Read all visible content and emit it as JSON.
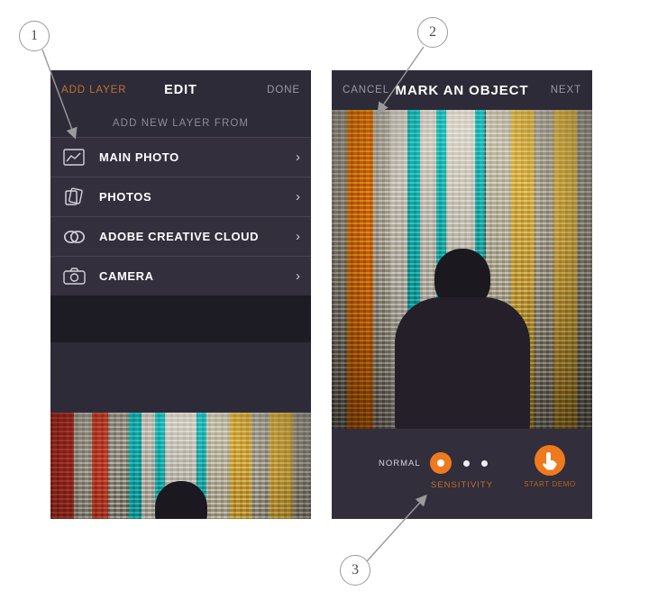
{
  "page": {
    "background": "#ffffff",
    "accent": "#c0702d",
    "accent_bright": "#ef7a1e",
    "panel_bg": "#2e2b39"
  },
  "left_phone": {
    "navbar": {
      "left_label": "ADD LAYER",
      "title": "EDIT",
      "right_label": "DONE"
    },
    "section_header": "ADD NEW LAYER FROM",
    "items": [
      {
        "label": "MAIN PHOTO",
        "icon": "image-icon",
        "chevron": "›"
      },
      {
        "label": "PHOTOS",
        "icon": "photos-stack-icon",
        "chevron": "›"
      },
      {
        "label": "ADOBE CREATIVE CLOUD",
        "icon": "adobe-creative-cloud-icon",
        "chevron": "›"
      },
      {
        "label": "CAMERA",
        "icon": "camera-icon",
        "chevron": "›"
      }
    ]
  },
  "right_phone": {
    "navbar": {
      "left_label": "CANCEL",
      "title": "MARK AN OBJECT",
      "right_label": "NEXT"
    },
    "controls": {
      "mode_label": "NORMAL",
      "sensitivity_label": "SENSITIVITY",
      "sensitivity_selected_index": 0,
      "sensitivity_steps": 3,
      "demo_label": "START DEMO",
      "demo_icon": "pointing-hand-icon"
    }
  },
  "callouts": [
    {
      "number": "1"
    },
    {
      "number": "2"
    },
    {
      "number": "3"
    }
  ]
}
